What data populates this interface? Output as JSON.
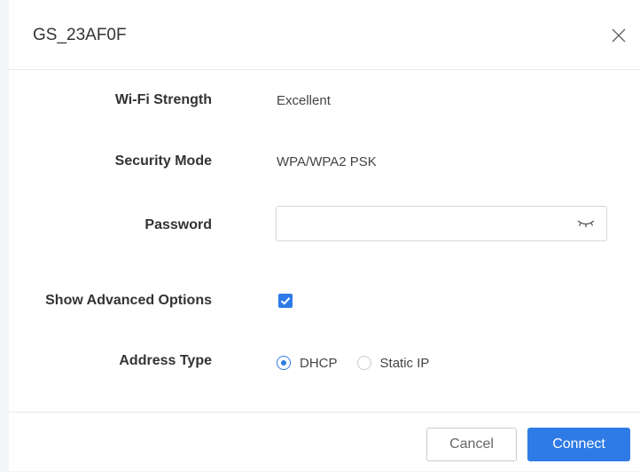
{
  "dialog": {
    "title": "GS_23AF0F"
  },
  "fields": {
    "wifi_strength": {
      "label": "Wi-Fi Strength",
      "value": "Excellent"
    },
    "security_mode": {
      "label": "Security Mode",
      "value": "WPA/WPA2 PSK"
    },
    "password": {
      "label": "Password",
      "value": "",
      "placeholder": ""
    },
    "show_advanced": {
      "label": "Show Advanced Options",
      "checked": true
    },
    "address_type": {
      "label": "Address Type",
      "options": [
        {
          "label": "DHCP",
          "selected": true
        },
        {
          "label": "Static IP",
          "selected": false
        }
      ]
    }
  },
  "footer": {
    "cancel_label": "Cancel",
    "connect_label": "Connect"
  },
  "colors": {
    "accent": "#2e7be6",
    "border": "#d4d7dc",
    "text": "#333333"
  },
  "icons": {
    "close": "close-icon",
    "password_toggle": "eye-closed-icon",
    "check": "checkmark-icon"
  }
}
